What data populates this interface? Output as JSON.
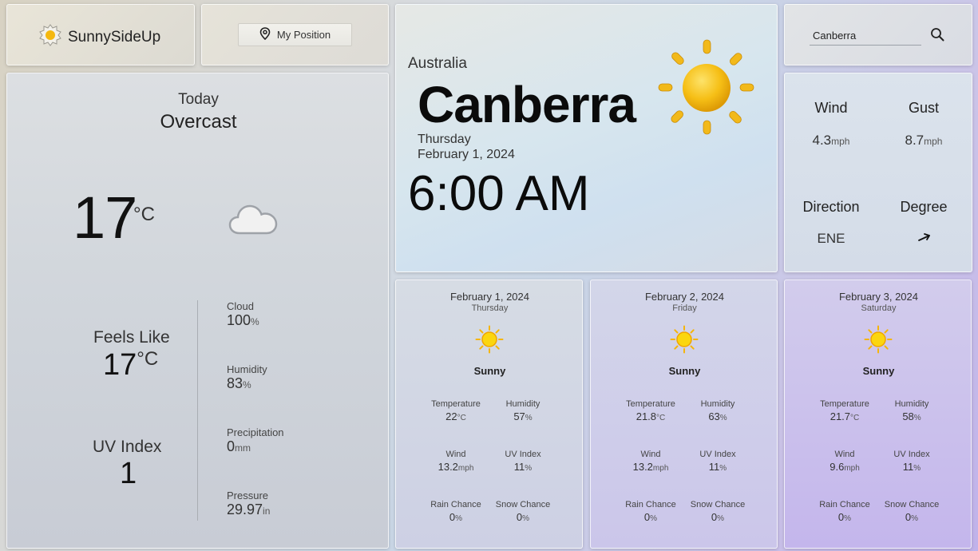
{
  "app": {
    "name": "SunnySideUp"
  },
  "position_button": {
    "label": "My Position"
  },
  "search": {
    "value": "Canberra"
  },
  "today": {
    "label": "Today",
    "condition": "Overcast",
    "temp": "17",
    "temp_unit": "°C",
    "feels_like_label": "Feels Like",
    "feels_like": "17",
    "feels_like_unit": "°C",
    "uv_label": "UV Index",
    "uv": "1",
    "stats": [
      {
        "label": "Cloud",
        "value": "100",
        "unit": "%"
      },
      {
        "label": "Humidity",
        "value": "83",
        "unit": "%"
      },
      {
        "label": "Precipitation",
        "value": "0",
        "unit": "mm"
      },
      {
        "label": "Pressure",
        "value": "29.97",
        "unit": "in"
      }
    ]
  },
  "location": {
    "country": "Australia",
    "city": "Canberra",
    "weekday": "Thursday",
    "date": "February 1, 2024",
    "time": "6:00 AM"
  },
  "wind": {
    "wind_label": "Wind",
    "wind_value": "4.3",
    "wind_unit": "mph",
    "gust_label": "Gust",
    "gust_value": "8.7",
    "gust_unit": "mph",
    "direction_label": "Direction",
    "direction_value": "ENE",
    "degree_label": "Degree",
    "degree_icon": "arrow-icon"
  },
  "forecast": [
    {
      "date": "February 1, 2024",
      "day": "Thursday",
      "condition": "Sunny",
      "temperature_label": "Temperature",
      "temperature": "22",
      "temperature_unit": "°C",
      "humidity_label": "Humidity",
      "humidity": "57",
      "humidity_unit": "%",
      "wind_label": "Wind",
      "wind": "13.2",
      "wind_unit": "mph",
      "uv_label": "UV Index",
      "uv": "11",
      "uv_unit": "%",
      "rain_label": "Rain Chance",
      "rain": "0",
      "rain_unit": "%",
      "snow_label": "Snow Chance",
      "snow": "0",
      "snow_unit": "%"
    },
    {
      "date": "February 2, 2024",
      "day": "Friday",
      "condition": "Sunny",
      "temperature_label": "Temperature",
      "temperature": "21.8",
      "temperature_unit": "°C",
      "humidity_label": "Humidity",
      "humidity": "63",
      "humidity_unit": "%",
      "wind_label": "Wind",
      "wind": "13.2",
      "wind_unit": "mph",
      "uv_label": "UV Index",
      "uv": "11",
      "uv_unit": "%",
      "rain_label": "Rain Chance",
      "rain": "0",
      "rain_unit": "%",
      "snow_label": "Snow Chance",
      "snow": "0",
      "snow_unit": "%"
    },
    {
      "date": "February 3, 2024",
      "day": "Saturday",
      "condition": "Sunny",
      "temperature_label": "Temperature",
      "temperature": "21.7",
      "temperature_unit": "°C",
      "humidity_label": "Humidity",
      "humidity": "58",
      "humidity_unit": "%",
      "wind_label": "Wind",
      "wind": "9.6",
      "wind_unit": "mph",
      "uv_label": "UV Index",
      "uv": "11",
      "uv_unit": "%",
      "rain_label": "Rain Chance",
      "rain": "0",
      "rain_unit": "%",
      "snow_label": "Snow Chance",
      "snow": "0",
      "snow_unit": "%"
    }
  ],
  "colors": {
    "sun": "#f7c21a",
    "sun_ray": "#f0b817",
    "text": "#1a1a1a"
  }
}
